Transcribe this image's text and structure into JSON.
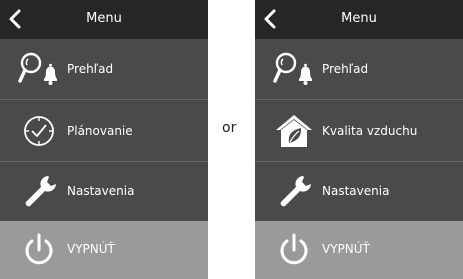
{
  "connector_text": "or",
  "colors": {
    "header_bg": "#262626",
    "item_bg": "#4a4a4a",
    "power_item_bg": "#9a9a9a",
    "text": "#ffffff"
  },
  "left_menu": {
    "back_icon": "chevron-left-icon",
    "title": "Menu",
    "items": [
      {
        "label": "Prehľad",
        "icon": "magnifier-bell-icon"
      },
      {
        "label": "Plánovanie",
        "icon": "clock-icon"
      },
      {
        "label": "Nastavenia",
        "icon": "wrench-icon"
      },
      {
        "label": "VYPNÚŤ",
        "icon": "power-icon"
      }
    ]
  },
  "right_menu": {
    "back_icon": "chevron-left-icon",
    "title": "Menu",
    "items": [
      {
        "label": "Prehľad",
        "icon": "magnifier-bell-icon"
      },
      {
        "label": "Kvalita vzduchu",
        "icon": "house-leaf-icon"
      },
      {
        "label": "Nastavenia",
        "icon": "wrench-icon"
      },
      {
        "label": "VYPNÚŤ",
        "icon": "power-icon"
      }
    ]
  }
}
